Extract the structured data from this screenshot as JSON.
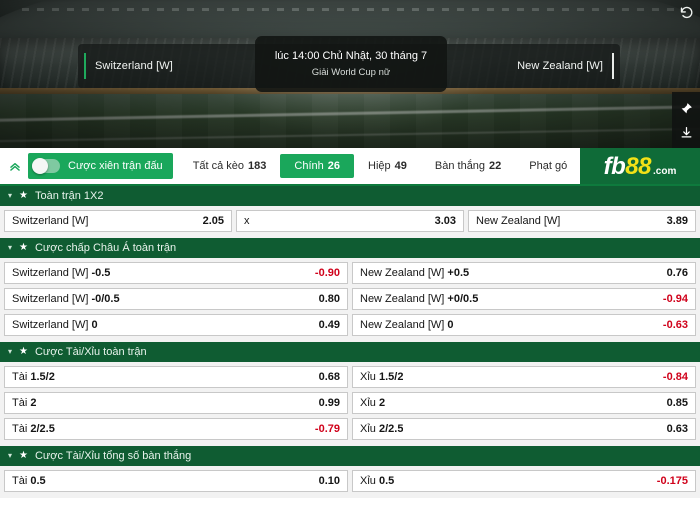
{
  "banner": {
    "home_team": "Switzerland [W]",
    "away_team": "New Zealand [W]",
    "match_time": "lúc 14:00 Chủ Nhật, 30 tháng 7",
    "league": "Giải World Cup nữ",
    "icons": {
      "refresh": "refresh-icon",
      "pin": "pin-icon",
      "download": "download-icon"
    }
  },
  "navbar": {
    "collapse_icon": "chevron-up-icon",
    "parlay_label": "Cược xiên trận đấu",
    "tabs": [
      {
        "label": "Tất cả kèo",
        "count": "183",
        "active": false
      },
      {
        "label": "Chính",
        "count": "26",
        "active": true
      },
      {
        "label": "Hiệp",
        "count": "49",
        "active": false
      },
      {
        "label": "Bàn thắng",
        "count": "22",
        "active": false
      },
      {
        "label": "Phạt gó",
        "count": "",
        "active": false
      }
    ],
    "logo": {
      "fb": "fb",
      "n88": "88",
      "dotcom": ".com"
    }
  },
  "accent_colors": {
    "brand_green": "#1aa75b",
    "header_green": "#0f5c32",
    "logo_green": "#0f6b38",
    "logo_yellow": "#f2e117",
    "negative_red": "#d0021b"
  },
  "markets": [
    {
      "title": "Toàn trận 1X2",
      "caret": "▾",
      "star": "★",
      "rows": [
        [
          {
            "label": "Switzerland [W]",
            "bold": "",
            "odds": "2.05",
            "negative": false
          },
          {
            "label": "x",
            "bold": "",
            "odds": "3.03",
            "negative": false
          },
          {
            "label": "New Zealand [W]",
            "bold": "",
            "odds": "3.89",
            "negative": false
          }
        ]
      ]
    },
    {
      "title": "Cược chấp Châu Á toàn trận",
      "caret": "▾",
      "star": "★",
      "rows": [
        [
          {
            "label": "Switzerland [W] ",
            "bold": "-0.5",
            "odds": "-0.90",
            "negative": true
          },
          {
            "label": "New Zealand [W] ",
            "bold": "+0.5",
            "odds": "0.76",
            "negative": false
          }
        ],
        [
          {
            "label": "Switzerland [W] ",
            "bold": "-0/0.5",
            "odds": "0.80",
            "negative": false
          },
          {
            "label": "New Zealand [W] ",
            "bold": "+0/0.5",
            "odds": "-0.94",
            "negative": true
          }
        ],
        [
          {
            "label": "Switzerland [W] ",
            "bold": "0",
            "odds": "0.49",
            "negative": false
          },
          {
            "label": "New Zealand [W] ",
            "bold": "0",
            "odds": "-0.63",
            "negative": true
          }
        ]
      ]
    },
    {
      "title": "Cược Tài/Xỉu toàn trận",
      "caret": "▾",
      "star": "★",
      "rows": [
        [
          {
            "label": "Tài ",
            "bold": "1.5/2",
            "odds": "0.68",
            "negative": false
          },
          {
            "label": "Xỉu ",
            "bold": "1.5/2",
            "odds": "-0.84",
            "negative": true
          }
        ],
        [
          {
            "label": "Tài ",
            "bold": "2",
            "odds": "0.99",
            "negative": false
          },
          {
            "label": "Xỉu ",
            "bold": "2",
            "odds": "0.85",
            "negative": false
          }
        ],
        [
          {
            "label": "Tài ",
            "bold": "2/2.5",
            "odds": "-0.79",
            "negative": true
          },
          {
            "label": "Xỉu ",
            "bold": "2/2.5",
            "odds": "0.63",
            "negative": false
          }
        ]
      ]
    },
    {
      "title": "Cược Tài/Xỉu tổng số bàn thắng",
      "caret": "▾",
      "star": "★",
      "rows": [
        [
          {
            "label": "Tài ",
            "bold": "0.5",
            "odds": "0.10",
            "negative": false
          },
          {
            "label": "Xỉu ",
            "bold": "0.5",
            "odds": "-0.175",
            "negative": true
          }
        ]
      ]
    }
  ]
}
